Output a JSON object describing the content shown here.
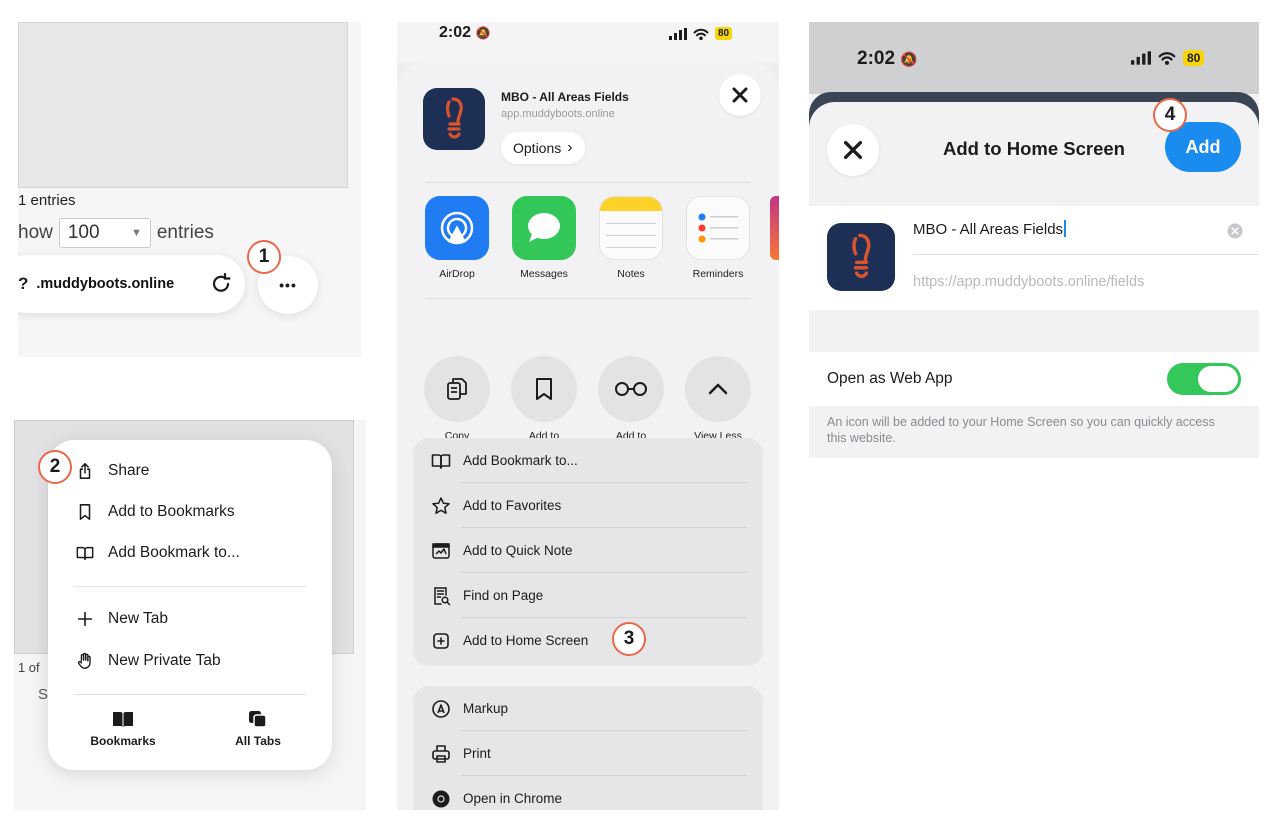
{
  "steps": [
    "1",
    "2",
    "3",
    "4"
  ],
  "panel1": {
    "entries_fragment": "1 entries",
    "show_fragment": "how",
    "entries_select_value": "100",
    "entries_suffix": "entries",
    "url_prefix": "?",
    "url_text": ".muddyboots.online",
    "more_label": "•••"
  },
  "panel2": {
    "menu_items": [
      {
        "label": "Share",
        "icon": "share-icon"
      },
      {
        "label": "Add to Bookmarks",
        "icon": "bookmark-icon"
      },
      {
        "label": "Add Bookmark to...",
        "icon": "book-icon"
      },
      {
        "label": "New Tab",
        "icon": "plus-icon"
      },
      {
        "label": "New Private Tab",
        "icon": "hand-icon"
      }
    ],
    "bottom_tabs": [
      {
        "label": "Bookmarks",
        "icon": "book-icon"
      },
      {
        "label": "All Tabs",
        "icon": "tabs-icon"
      }
    ],
    "bg_fragment_1": "› 1 of",
    "bg_fragment_2": "S"
  },
  "status_bar": {
    "time": "2:02",
    "battery": "80"
  },
  "panel3": {
    "app_title": "MBO - All Areas Fields",
    "app_url": "app.muddyboots.online",
    "options_label": "Options",
    "share_apps": [
      {
        "label": "AirDrop",
        "icon": "airdrop-icon",
        "color": "#1f7cf2"
      },
      {
        "label": "Messages",
        "icon": "messages-icon",
        "color": "#33c759"
      },
      {
        "label": "Notes",
        "icon": "notes-icon",
        "color": "#fbfbfb"
      },
      {
        "label": "Reminders",
        "icon": "reminders-icon",
        "color": "#fbfbfb"
      }
    ],
    "actions": [
      {
        "label": "Copy",
        "icon": "copy-icon"
      },
      {
        "label": "Add to\nBookmarks",
        "icon": "bookmark-icon"
      },
      {
        "label": "Add to\nReading List",
        "icon": "glasses-icon"
      },
      {
        "label": "View Less",
        "icon": "chevron-up-icon"
      }
    ],
    "list_group_1": [
      {
        "label": "Add Bookmark to...",
        "icon": "book-icon"
      },
      {
        "label": "Add to Favorites",
        "icon": "star-icon"
      },
      {
        "label": "Add to Quick Note",
        "icon": "quick-note-icon"
      },
      {
        "label": "Find on Page",
        "icon": "find-icon"
      },
      {
        "label": "Add to Home Screen",
        "icon": "plus-square-icon"
      }
    ],
    "list_group_2": [
      {
        "label": "Markup",
        "icon": "markup-icon"
      },
      {
        "label": "Print",
        "icon": "print-icon"
      },
      {
        "label": "Open in Chrome",
        "icon": "chrome-icon"
      }
    ]
  },
  "panel4": {
    "title": "Add to Home Screen",
    "add_label": "Add",
    "name_value": "MBO - All Areas Fields",
    "url_value": "https://app.muddyboots.online/fields",
    "toggle_label": "Open as Web App",
    "toggle_on": true,
    "footnote": "An icon will be added to your Home Screen so you can quickly access this website."
  },
  "colors": {
    "step_ring": "#e8684a",
    "ios_blue": "#1a8cf0",
    "toggle_green": "#34c759",
    "app_icon_bg": "#1d2f55",
    "app_icon_boot": "#d9542d",
    "battery_yellow": "#f6d60a"
  }
}
